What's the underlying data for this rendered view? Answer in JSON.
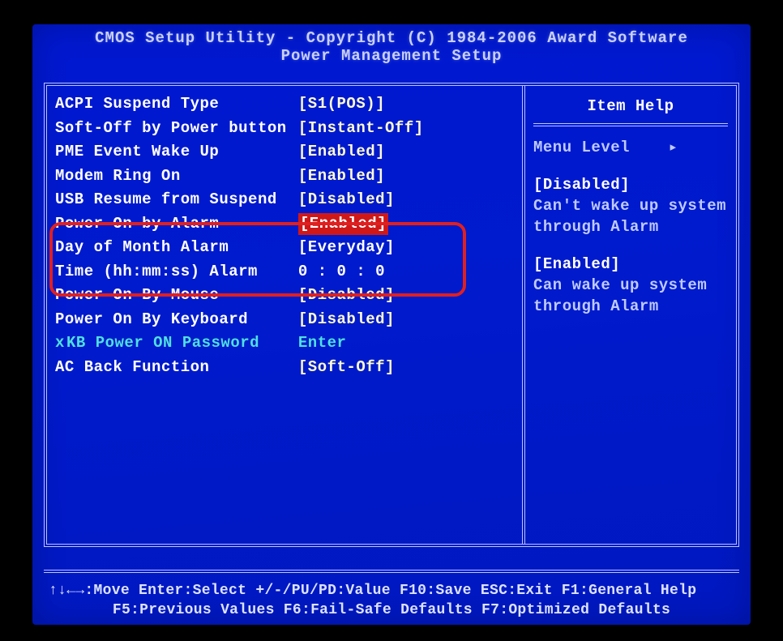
{
  "header": {
    "title1": "CMOS Setup Utility - Copyright (C) 1984-2006 Award Software",
    "title2": "Power Management Setup"
  },
  "settings": [
    {
      "label": "ACPI Suspend Type",
      "value": "[S1(POS)]"
    },
    {
      "label": "Soft-Off by Power button",
      "value": "[Instant-Off]"
    },
    {
      "label": "PME Event Wake Up",
      "value": "[Enabled]"
    },
    {
      "label": "Modem Ring On",
      "value": "[Enabled]"
    },
    {
      "label": "USB Resume from Suspend",
      "value": "[Disabled]"
    },
    {
      "label": "Power-On by Alarm",
      "value": "[Enabled]",
      "highlight": true
    },
    {
      "label": "Day of Month Alarm",
      "value": "[Everyday]"
    },
    {
      "label": "Time (hh:mm:ss) Alarm",
      "value": " 0 :  0 :  0"
    },
    {
      "label": "Power On By Mouse",
      "value": "[Disabled]"
    },
    {
      "label": "Power On By Keyboard",
      "value": "[Disabled]"
    },
    {
      "label": "KB Power ON Password",
      "value": "Enter",
      "disabled": true,
      "marker": "x"
    },
    {
      "label": "AC Back Function",
      "value": "[Soft-Off]"
    }
  ],
  "help": {
    "title": "Item Help",
    "menu_level": "Menu Level",
    "arrow": "▸",
    "disabled_head": "[Disabled]",
    "disabled_l1": "Can't wake up system",
    "disabled_l2": "through Alarm",
    "enabled_head": "[Enabled]",
    "enabled_l1": "Can wake up system",
    "enabled_l2": "through Alarm"
  },
  "keys": {
    "row1": "↑↓←→:Move   Enter:Select   +/-/PU/PD:Value   F10:Save   ESC:Exit   F1:General Help",
    "row2": "F5:Previous Values   F6:Fail-Safe Defaults   F7:Optimized Defaults"
  }
}
